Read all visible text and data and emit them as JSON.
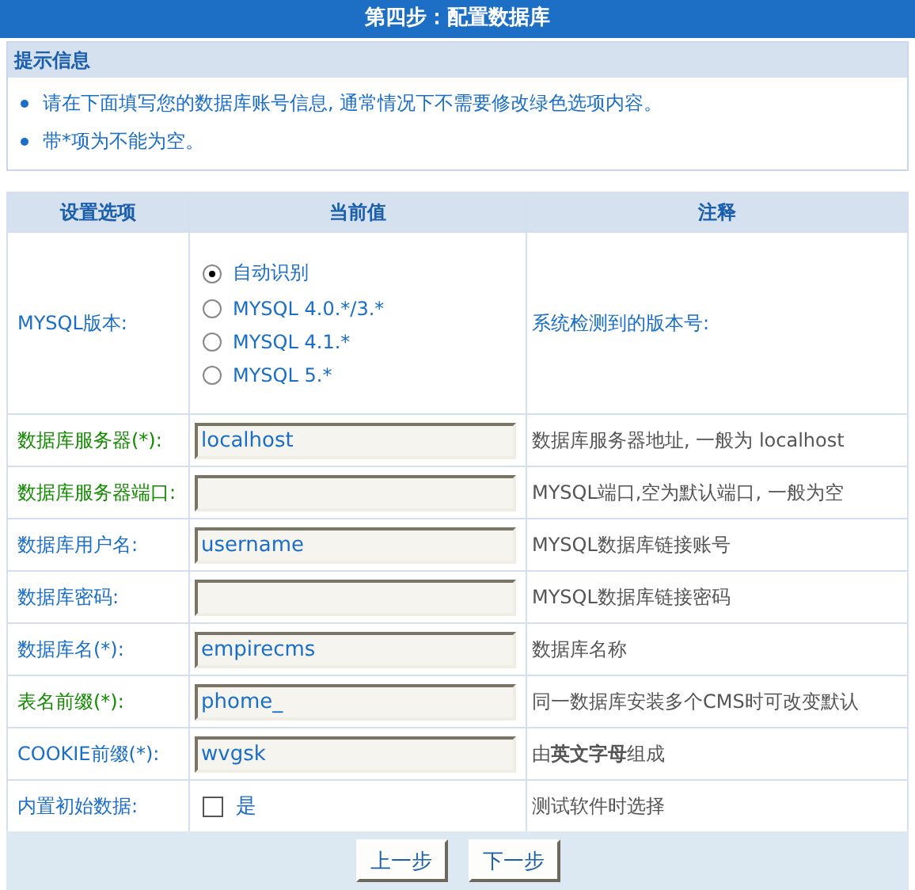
{
  "title": "第四步：配置数据库",
  "tips": {
    "heading": "提示信息",
    "items": [
      "请在下面填写您的数据库账号信息, 通常情况下不需要修改绿色选项内容。",
      "带*项为不能为空。"
    ]
  },
  "table": {
    "columns": [
      "设置选项",
      "当前值",
      "注释"
    ],
    "rows": [
      {
        "kind": "radio",
        "label": "MYSQL版本:",
        "color": "#1a6ec8",
        "options": [
          {
            "label": "自动识别",
            "selected": true
          },
          {
            "label": "MYSQL 4.0.*/3.*",
            "selected": false
          },
          {
            "label": "MYSQL 4.1.*",
            "selected": false
          },
          {
            "label": "MYSQL 5.*",
            "selected": false
          }
        ],
        "note": {
          "text": "系统检测到的版本号:",
          "color": "#1a6ec8"
        }
      },
      {
        "kind": "input",
        "label": "数据库服务器(*):",
        "color": "#138a00",
        "value": "localhost",
        "note": "数据库服务器地址, 一般为  localhost"
      },
      {
        "kind": "input",
        "label": "数据库服务器端口:",
        "color": "#138a00",
        "note": "MYSQL端口,空为默认端口, 一般为空"
      },
      {
        "kind": "input",
        "label": "数据库用户名:",
        "color": "#1a6ec8",
        "value": "username",
        "note": "MYSQL数据库链接账号"
      },
      {
        "kind": "input",
        "label": "数据库密码:",
        "color": "#1a6ec8",
        "note": "MYSQL数据库链接密码"
      },
      {
        "kind": "input",
        "label": "数据库名(*):",
        "color": "#1a6ec8",
        "value": "empirecms",
        "note": "数据库名称"
      },
      {
        "kind": "input",
        "label": "表名前缀(*):",
        "color": "#138a00",
        "value": "phome_",
        "note": "同一数据库安装多个CMS时可改变默认"
      },
      {
        "kind": "input",
        "label": "COOKIE前缀(*):",
        "color": "#1a6ec8",
        "value": "wvgsk",
        "note": "由**英文字母**组成"
      },
      {
        "kind": "checkbox",
        "label": "内置初始数据:",
        "color": "#1a6ec8",
        "option": "是",
        "checked": false,
        "note": "测试软件时选择"
      }
    ]
  },
  "buttons": [
    "上一步",
    "下一步"
  ]
}
